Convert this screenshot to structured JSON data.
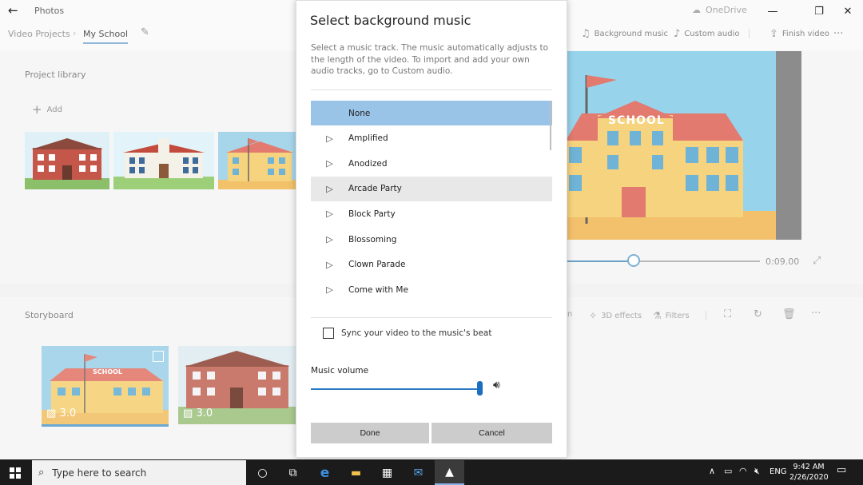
{
  "app": {
    "title": "Photos",
    "onedrive": "OneDrive",
    "minimize": "—",
    "maximize": "❐",
    "close": "✕"
  },
  "breadcrumb": {
    "root": "Video Projects",
    "current": "My School"
  },
  "toolbar": {
    "background_music": "Background music",
    "custom_audio": "Custom audio",
    "finish_video": "Finish video",
    "more": "···"
  },
  "library": {
    "title": "Project library",
    "add_label": "Add"
  },
  "preview": {
    "sign_text": "SCHOOL",
    "time": "0:09.00",
    "progress_fraction": 0.35
  },
  "storyboard": {
    "title": "Storyboard",
    "tools": {
      "effects": "3D effects",
      "filters": "Filters",
      "partial": "n"
    },
    "cards": [
      {
        "duration": "3.0"
      },
      {
        "duration": "3.0"
      }
    ]
  },
  "dialog": {
    "title": "Select background music",
    "description": "Select a music track. The music automatically adjusts to the length of the video. To import and add your own audio tracks, go to Custom audio.",
    "tracks": [
      {
        "name": "None",
        "state": "selected"
      },
      {
        "name": "Amplified",
        "state": ""
      },
      {
        "name": "Anodized",
        "state": ""
      },
      {
        "name": "Arcade Party",
        "state": "hover"
      },
      {
        "name": "Block Party",
        "state": ""
      },
      {
        "name": "Blossoming",
        "state": ""
      },
      {
        "name": "Clown Parade",
        "state": ""
      },
      {
        "name": "Come with Me",
        "state": ""
      }
    ],
    "sync_label": "Sync your video to the music's beat",
    "sync_checked": false,
    "volume_label": "Music volume",
    "volume_fraction": 1.0,
    "done_label": "Done",
    "cancel_label": "Cancel"
  },
  "taskbar": {
    "search_placeholder": "Type here to search",
    "language": "ENG",
    "time": "9:42 AM",
    "date": "2/26/2020"
  },
  "colors": {
    "accent": "#1a6fc0",
    "selected_row": "#99c4e8",
    "taskbar": "#1b1b1b"
  }
}
